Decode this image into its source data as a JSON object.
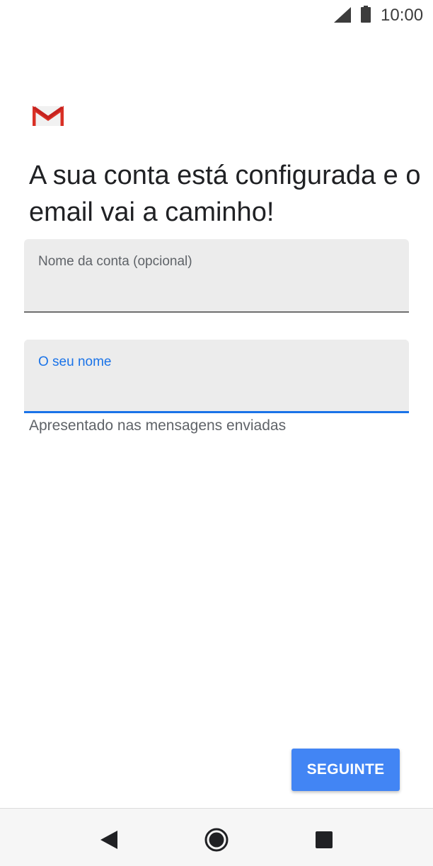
{
  "status_bar": {
    "time": "10:00",
    "icons": [
      "signal-icon",
      "battery-icon"
    ]
  },
  "app": {
    "logo": "gmail-logo",
    "brand_colors": {
      "red": "#d93025",
      "envelope": "#f1f1f1"
    }
  },
  "headline": "A sua conta está configurada e o email vai a caminho!",
  "fields": {
    "account_name": {
      "label": "Nome da conta (opcional)",
      "value": ""
    },
    "your_name": {
      "label": "O seu nome",
      "value": "",
      "helper": "Apresentado nas mensagens enviadas"
    }
  },
  "next_button": {
    "label": "SEGUINTE",
    "color": "#4285f4"
  },
  "nav_bar": {
    "icons": [
      "back-icon",
      "home-icon",
      "recents-icon"
    ]
  }
}
